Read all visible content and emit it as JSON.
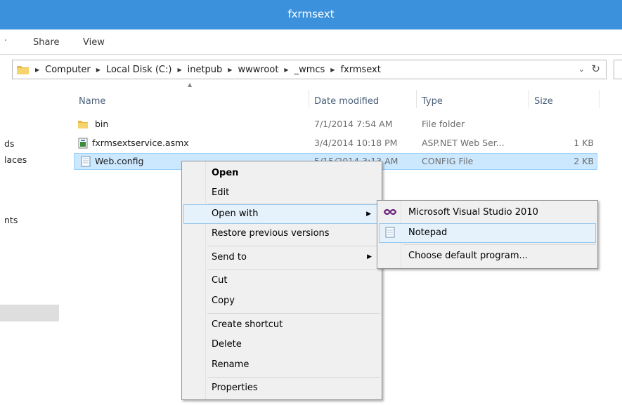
{
  "window": {
    "title": "fxrmsext"
  },
  "ribbon": {
    "tabs": [
      "Share",
      "View"
    ]
  },
  "address": {
    "crumbs": [
      "Computer",
      "Local Disk (C:)",
      "inetpub",
      "wwwroot",
      "_wmcs",
      "fxrmsext"
    ]
  },
  "nav": {
    "fragments": [
      "ds",
      "laces",
      "nts"
    ]
  },
  "columns": {
    "name": "Name",
    "date": "Date modified",
    "type": "Type",
    "size": "Size"
  },
  "files": [
    {
      "name": "bin",
      "date": "7/1/2014 7:54 AM",
      "type": "File folder",
      "size": "",
      "icon": "folder-icon"
    },
    {
      "name": "fxrmsextservice.asmx",
      "date": "3/4/2014 10:18 PM",
      "type": "ASP.NET Web Ser...",
      "size": "1 KB",
      "icon": "asmx-file-icon"
    },
    {
      "name": "Web.config",
      "date": "5/15/2014 3:13 AM",
      "type": "CONFIG File",
      "size": "2 KB",
      "icon": "config-file-icon",
      "selected": true
    }
  ],
  "context_menu": {
    "items": [
      "Open",
      "Edit",
      "Open with",
      "Restore previous versions",
      "Send to",
      "Cut",
      "Copy",
      "Create shortcut",
      "Delete",
      "Rename",
      "Properties"
    ],
    "highlighted": "Open with"
  },
  "open_with_menu": {
    "items": [
      "Microsoft Visual Studio 2010",
      "Notepad",
      "Choose default program..."
    ],
    "highlighted": "Notepad"
  },
  "colors": {
    "titlebar": "#3c91dc",
    "selection": "#cce8ff",
    "menu_background": "#f0f0f0",
    "menu_highlight": "#e5f1fb"
  }
}
